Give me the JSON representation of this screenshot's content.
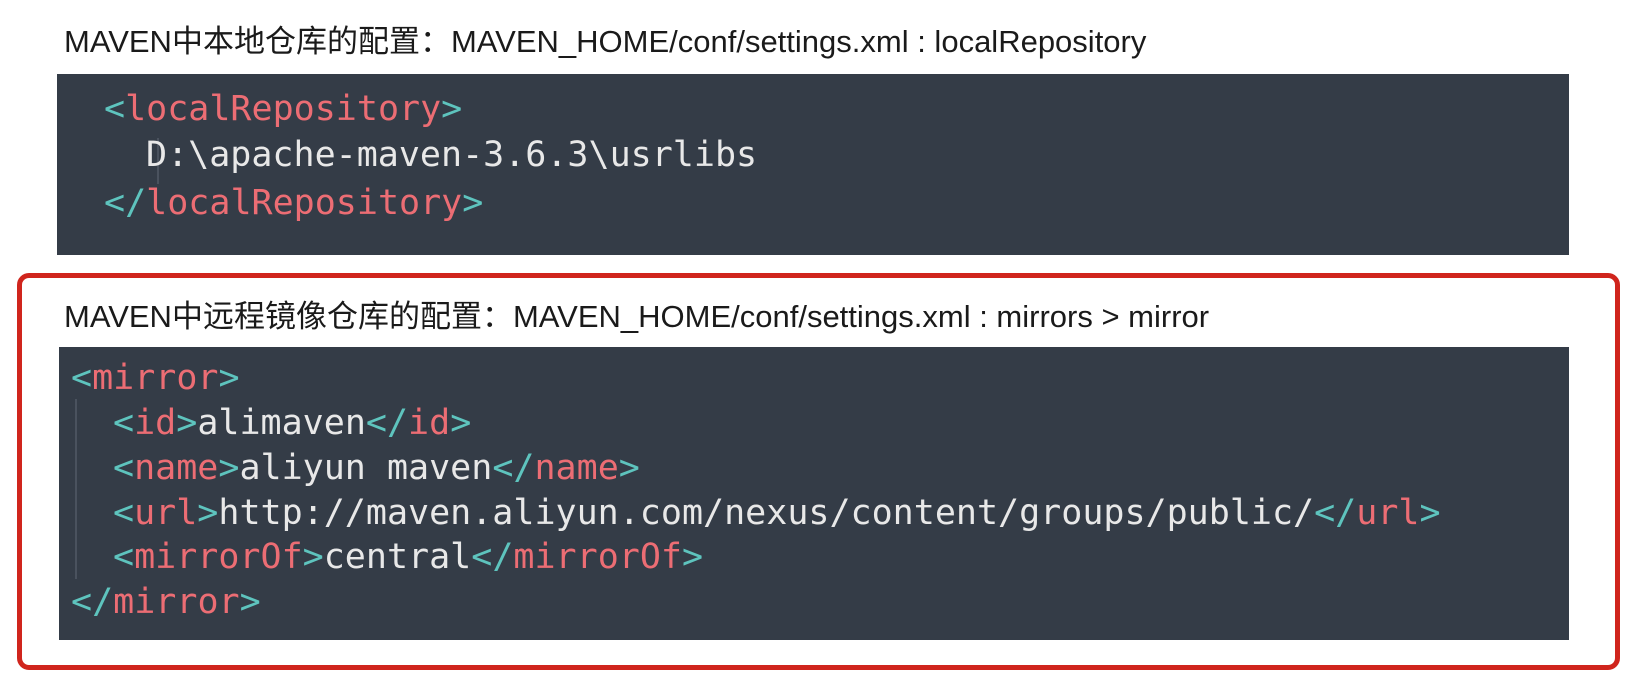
{
  "caption1": "MAVEN中本地仓库的配置：MAVEN_HOME/conf/settings.xml : localRepository",
  "caption2": "MAVEN中远程镜像仓库的配置：MAVEN_HOME/conf/settings.xml : mirrors > mirror",
  "local": {
    "open_tag": "localRepository",
    "value": "D:\\apache-maven-3.6.3\\usrlibs",
    "close_tag": "localRepository"
  },
  "mirror": {
    "tag": "mirror",
    "id_tag": "id",
    "id_value": "alimaven",
    "name_tag": "name",
    "name_value": "aliyun maven",
    "url_tag": "url",
    "url_value": "http://maven.aliyun.com/nexus/content/groups/public/",
    "mirrorof_tag": "mirrorOf",
    "mirrorof_value": "central"
  },
  "colors": {
    "code_bg": "#343c47",
    "bracket": "#5ec4be",
    "tag": "#ec6d74",
    "text": "#e8e8e8",
    "highlight_border": "#d0251d"
  }
}
